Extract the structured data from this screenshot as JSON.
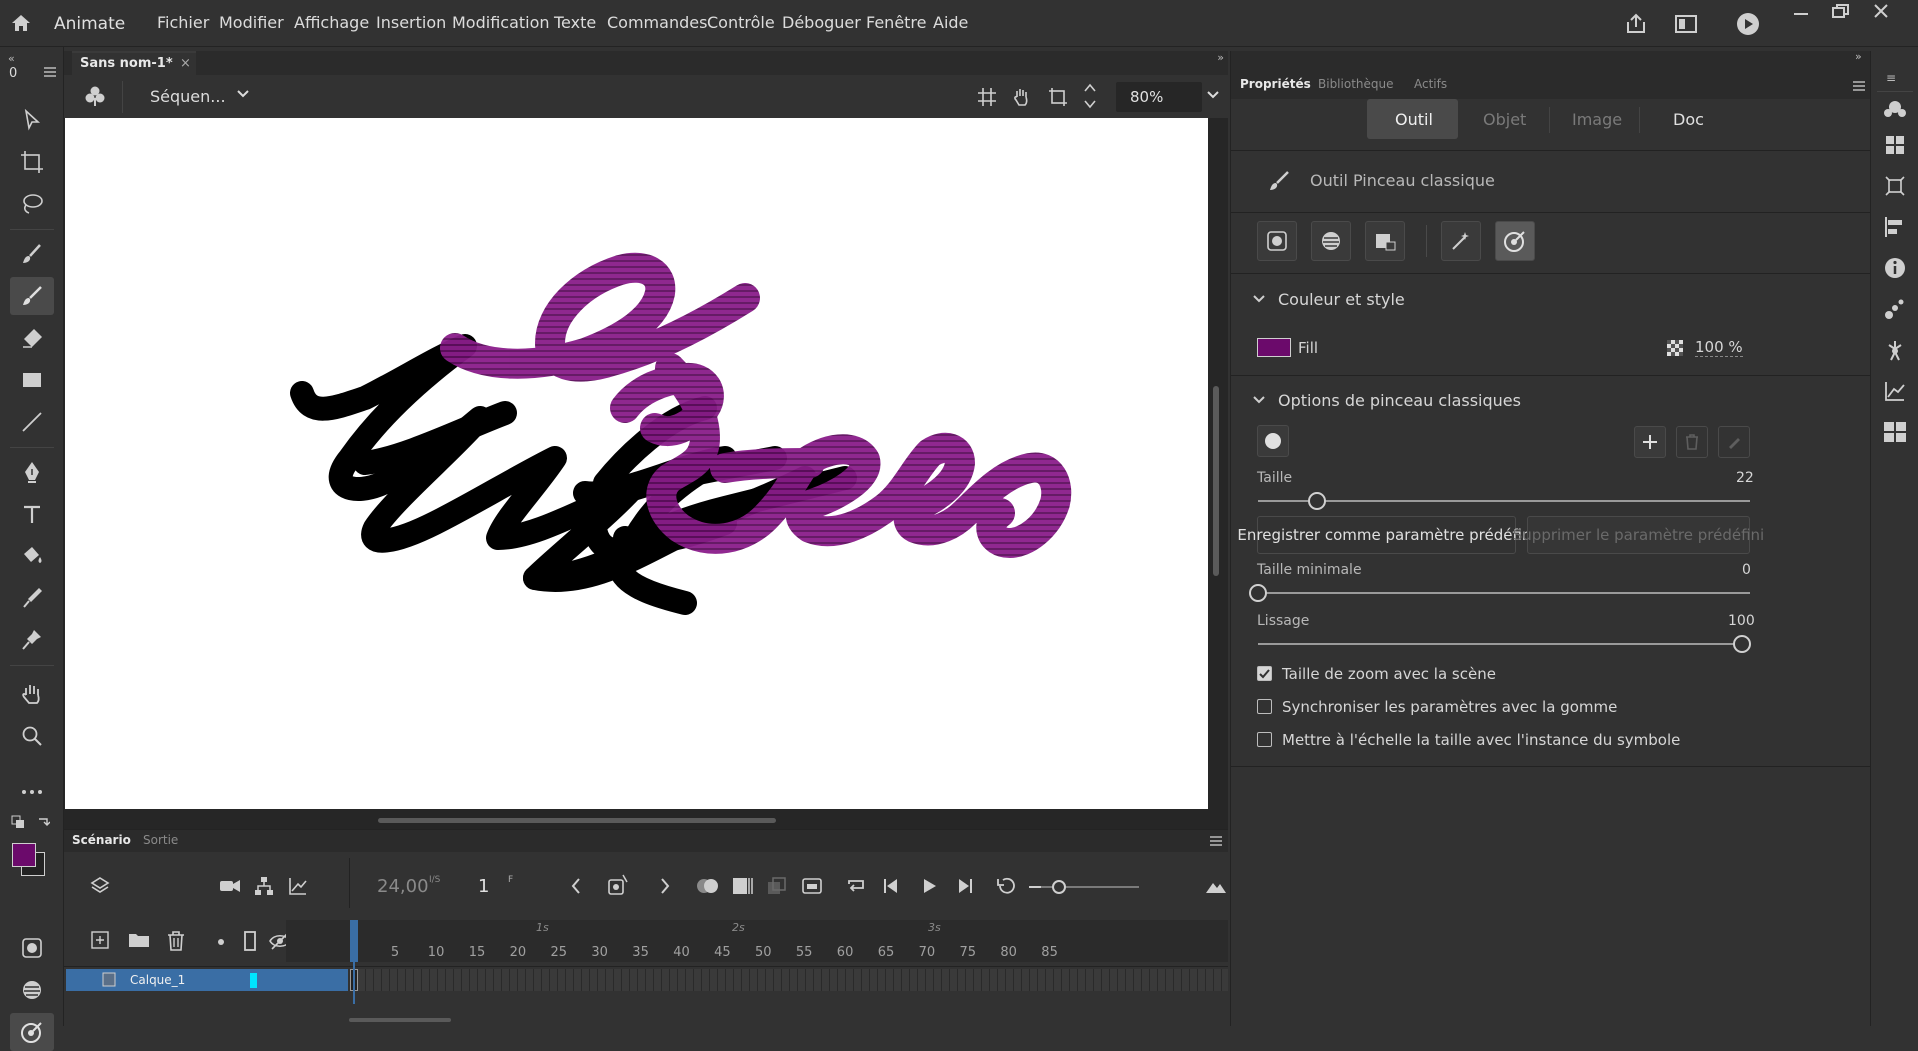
{
  "app": {
    "name": "Animate"
  },
  "menu": [
    "Fichier",
    "Modifier",
    "Affichage",
    "Insertion",
    "Modification",
    "Texte",
    "Commandes",
    "Contrôle",
    "Déboguer",
    "Fenêtre",
    "Aide"
  ],
  "document": {
    "tab_label": "Sans nom-1*",
    "scene_label": "Séquen...",
    "zoom": "80%"
  },
  "toolbar": {
    "counter": "0"
  },
  "timeline": {
    "tabs": [
      "Scénario",
      "Sortie"
    ],
    "fps": "24,00",
    "fps_unit": "I/S",
    "current_frame": "1",
    "frame_unit": "F",
    "seconds": [
      "1s",
      "2s",
      "3s"
    ],
    "frame_numbers": [
      "5",
      "10",
      "15",
      "20",
      "25",
      "30",
      "35",
      "40",
      "45",
      "50",
      "55",
      "60",
      "65",
      "70",
      "75",
      "80",
      "85"
    ],
    "layer_name": "Calque_1"
  },
  "properties": {
    "panel_tabs": [
      "Propriétés",
      "Bibliothèque",
      "Actifs"
    ],
    "segment_tabs": [
      "Outil",
      "Objet",
      "Image",
      "Doc"
    ],
    "tool_name": "Outil Pinceau classique",
    "color_section": {
      "title": "Couleur et style",
      "fill_label": "Fill",
      "fill_color": "#6b0a6b",
      "alpha": "100 %"
    },
    "brush_section": {
      "title": "Options de pinceau classiques",
      "size_label": "Taille",
      "size_value": "22",
      "size_fraction": 0.12,
      "save_preset": "Enregistrer comme paramètre prédéfini",
      "delete_preset": "Supprimer le paramètre prédéfini",
      "min_size_label": "Taille minimale",
      "min_size_value": "0",
      "min_size_fraction": 0.0,
      "smoothing_label": "Lissage",
      "smoothing_value": "100",
      "smoothing_fraction": 1.0,
      "checkboxes": [
        {
          "label": "Taille de zoom avec la scène",
          "checked": true
        },
        {
          "label": "Synchroniser les paramètres avec la gomme",
          "checked": false
        },
        {
          "label": "Mettre à l'échelle la taille avec l'instance du symbole",
          "checked": false
        }
      ]
    }
  },
  "colors": {
    "accent_blue": "#3a6ea5",
    "brush_purple": "#8a1d8a",
    "stroke_black": "#000000",
    "layer_cyan": "#00e5ff"
  }
}
